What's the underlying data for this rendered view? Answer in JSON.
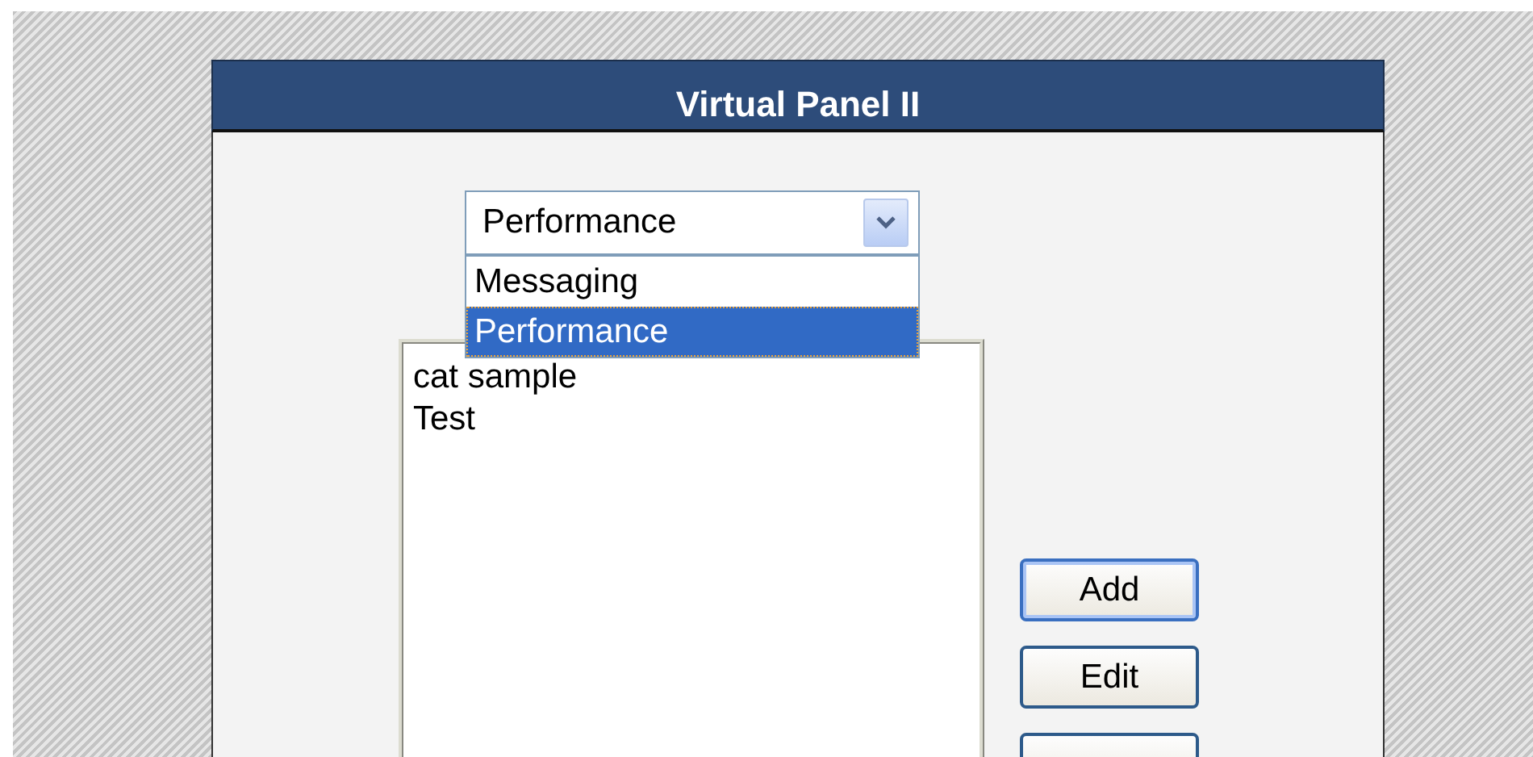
{
  "panel": {
    "title": "Virtual Panel II"
  },
  "category_select": {
    "value": "Performance",
    "expanded": true,
    "options": [
      {
        "label": "Messaging",
        "selected": false
      },
      {
        "label": "Performance",
        "selected": true
      }
    ]
  },
  "items_list": [
    {
      "label": "cat sample"
    },
    {
      "label": "Test"
    }
  ],
  "buttons": [
    {
      "label": "Add",
      "focused": true
    },
    {
      "label": "Edit",
      "focused": false
    },
    {
      "focused": false
    }
  ]
}
